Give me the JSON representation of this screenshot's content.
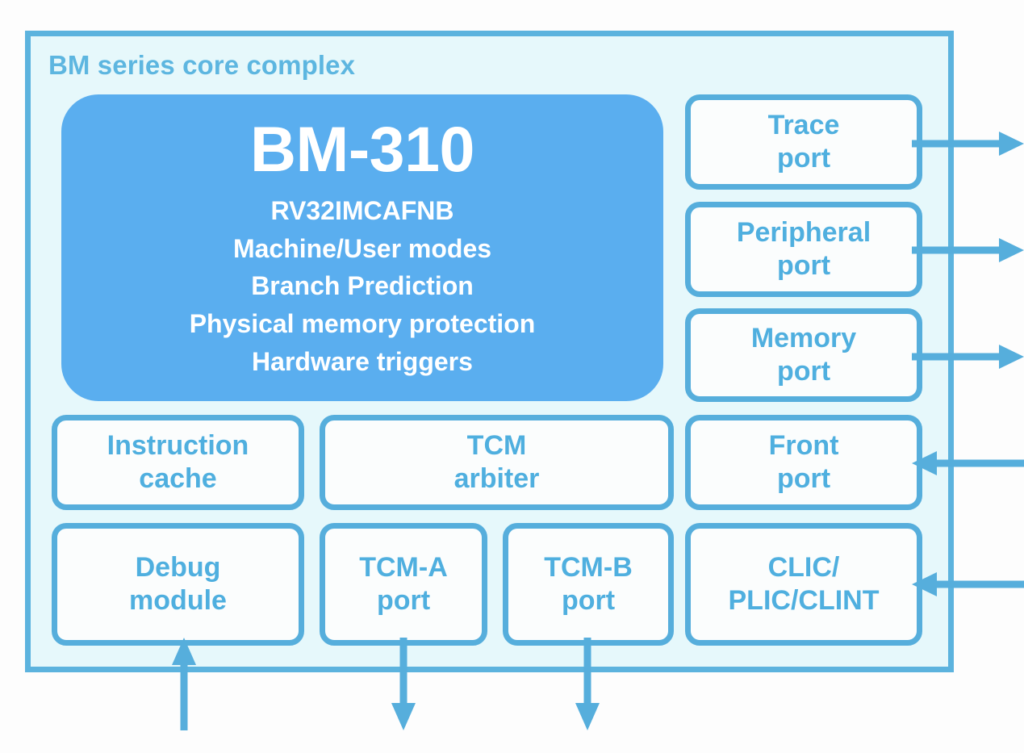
{
  "diagram": {
    "title": "BM series core complex",
    "colors": {
      "accent_border": "#56aedc",
      "accent_text": "#4fafdf",
      "cpu_fill": "#5aaeef",
      "complex_fill": "#e6f8fb",
      "module_fill": "#fbfdfd",
      "title_text": "#5db6e0",
      "cpu_text": "#ffffff"
    },
    "cpu": {
      "name": "BM-310",
      "features": [
        "RV32IMCAFNB",
        "Machine/User modes",
        "Branch Prediction",
        "Physical memory protection",
        "Hardware triggers"
      ]
    },
    "modules": {
      "trace_port": {
        "lines": [
          "Trace",
          "port"
        ]
      },
      "peripheral_port": {
        "lines": [
          "Peripheral",
          "port"
        ]
      },
      "memory_port": {
        "lines": [
          "Memory",
          "port"
        ]
      },
      "front_port": {
        "lines": [
          "Front",
          "port"
        ]
      },
      "clic_plic_clint": {
        "lines": [
          "CLIC/",
          "PLIC/CLINT"
        ]
      },
      "instruction_cache": {
        "lines": [
          "Instruction",
          "cache"
        ]
      },
      "tcm_arbiter": {
        "lines": [
          "TCM",
          "arbiter"
        ]
      },
      "debug_module": {
        "lines": [
          "Debug",
          "module"
        ]
      },
      "tcm_a_port": {
        "lines": [
          "TCM-A",
          "port"
        ]
      },
      "tcm_b_port": {
        "lines": [
          "TCM-B",
          "port"
        ]
      }
    },
    "connections": [
      {
        "from": "trace_port",
        "direction": "out",
        "orientation": "right"
      },
      {
        "from": "peripheral_port",
        "direction": "out",
        "orientation": "right"
      },
      {
        "from": "memory_port",
        "direction": "out",
        "orientation": "right"
      },
      {
        "from": "front_port",
        "direction": "in",
        "orientation": "left"
      },
      {
        "from": "clic_plic_clint",
        "direction": "in",
        "orientation": "left"
      },
      {
        "from": "debug_module",
        "direction": "in",
        "orientation": "up"
      },
      {
        "from": "tcm_a_port",
        "direction": "out",
        "orientation": "down"
      },
      {
        "from": "tcm_b_port",
        "direction": "out",
        "orientation": "down"
      }
    ]
  }
}
